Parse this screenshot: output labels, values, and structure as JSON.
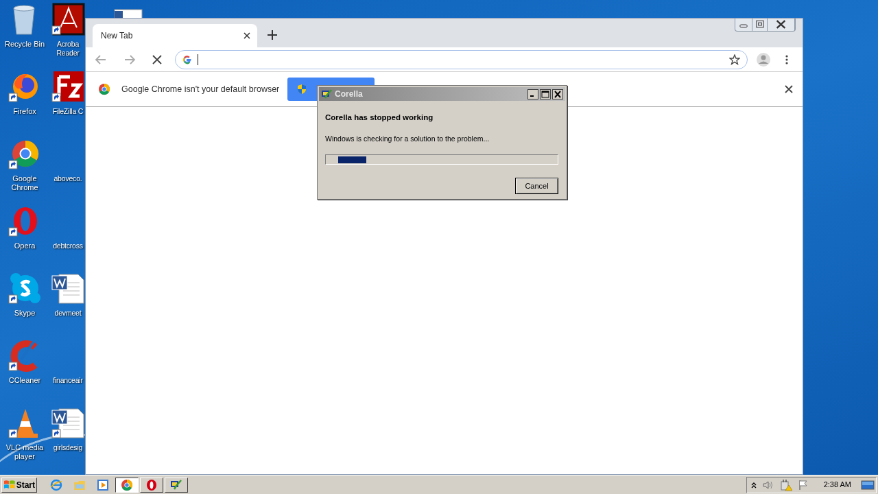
{
  "desktop": {
    "column_1": [
      {
        "label": "Recycle Bin"
      },
      {
        "label": "Firefox"
      },
      {
        "label": "Google Chrome"
      },
      {
        "label": "Opera"
      },
      {
        "label": "Skype"
      },
      {
        "label": "CCleaner"
      },
      {
        "label": "VLC media player"
      }
    ],
    "column_2": [
      {
        "label": "Acroba\nReader"
      },
      {
        "label": "FileZilla C"
      },
      {
        "label": "aboveco."
      },
      {
        "label": "debtcross"
      },
      {
        "label": "devmeet"
      },
      {
        "label": "financeair"
      },
      {
        "label": "girlsdesig"
      }
    ]
  },
  "browser": {
    "tabs": [
      {
        "label": "New Tab",
        "selected": true
      }
    ],
    "infobar": {
      "message": "Google Chrome isn't your default browser"
    }
  },
  "dialog": {
    "title": "Corella",
    "heading": "Corella has stopped working",
    "message": "Windows is checking for a solution to the problem...",
    "progress": {
      "level": 0.12
    },
    "buttons": [
      "Cancel"
    ]
  },
  "taskbar": {
    "start": "Start",
    "items": [
      {
        "selected": false
      },
      {
        "selected": false
      },
      {
        "selected": false
      },
      {
        "selected": true
      },
      {
        "selected": false
      },
      {
        "selected": false
      }
    ],
    "clock": "2:38 AM"
  }
}
